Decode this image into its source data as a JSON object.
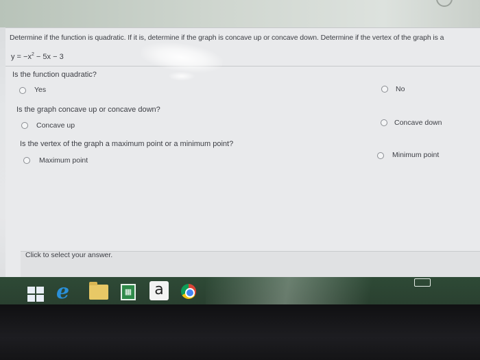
{
  "question": {
    "header": "Determine if the function is quadratic. If it is, determine if the graph is concave up or concave down. Determine if the vertex of the graph is a",
    "equation_prefix": "y = −x",
    "equation_exponent": "2",
    "equation_suffix": " − 5x − 3"
  },
  "parts": [
    {
      "prompt": "Is the function quadratic?",
      "option_a": "Yes",
      "option_b": "No"
    },
    {
      "prompt": "Is the graph concave up or concave down?",
      "option_a": "Concave up",
      "option_b": "Concave down"
    },
    {
      "prompt": "Is the vertex of the graph a maximum point or a minimum point?",
      "option_a": "Maximum point",
      "option_b": "Minimum point"
    }
  ],
  "footer": {
    "instruction": "Click to select your answer."
  },
  "taskbar": {
    "icons": [
      "windows-start-icon",
      "internet-explorer-icon",
      "file-explorer-icon",
      "store-icon",
      "amazon-icon",
      "chrome-icon",
      "touch-keyboard-icon"
    ],
    "amazon_glyph": "a"
  }
}
